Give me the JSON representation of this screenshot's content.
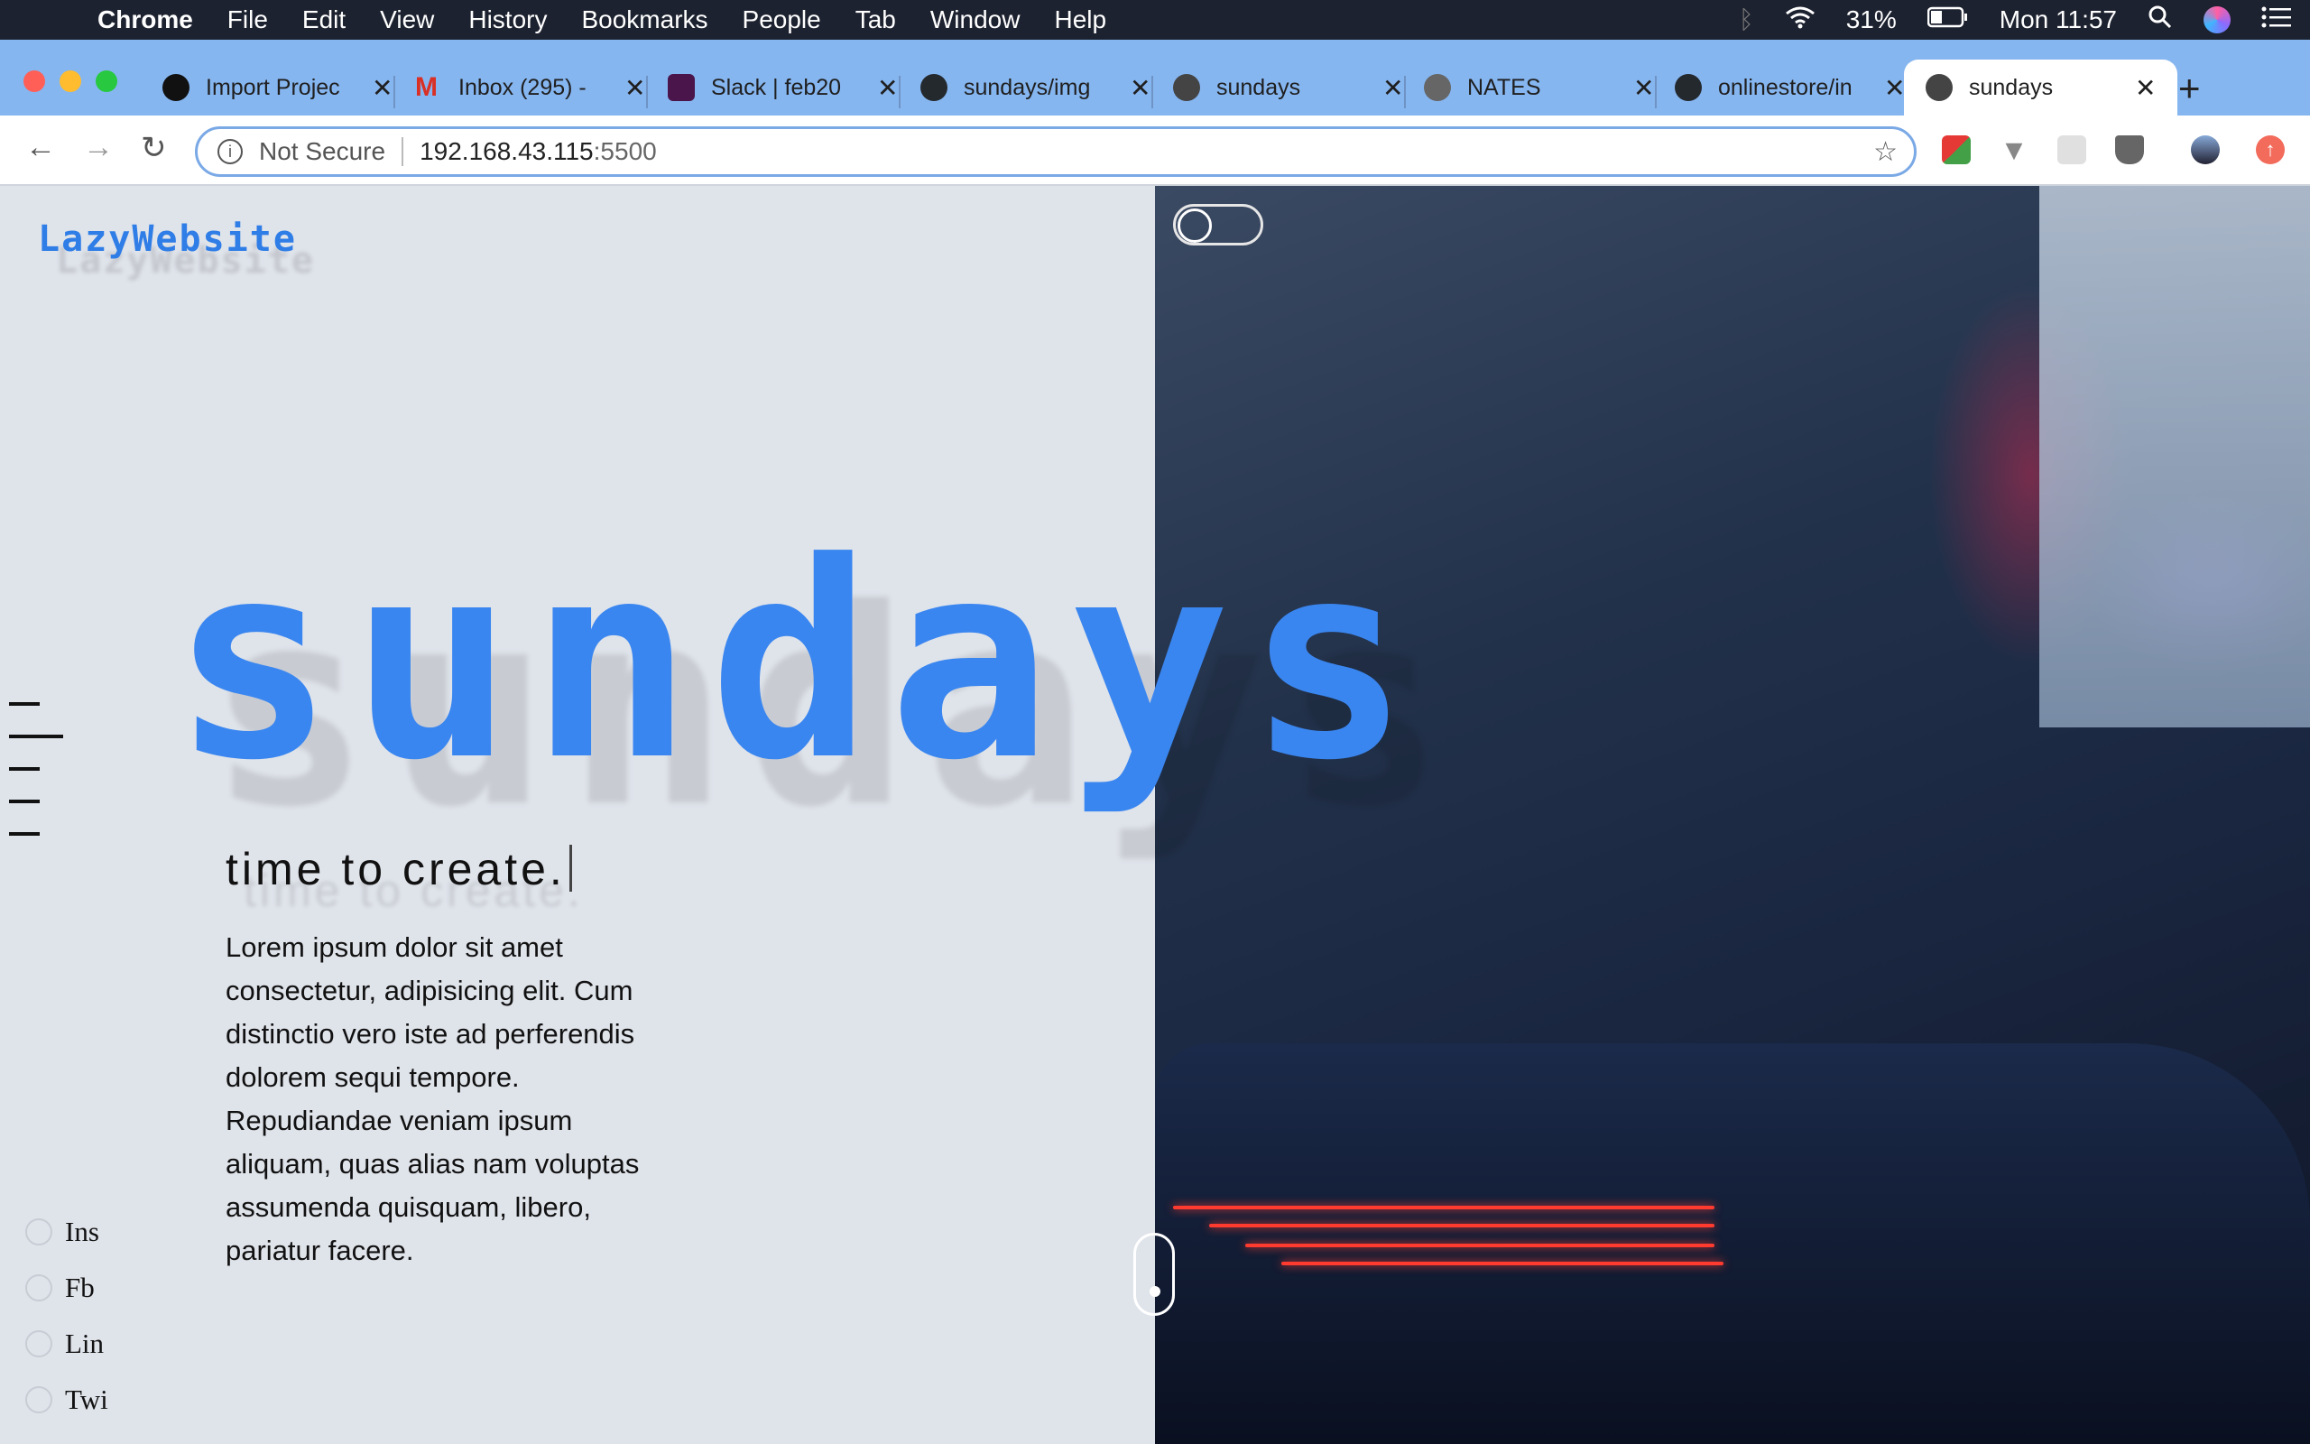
{
  "menubar": {
    "app": "Chrome",
    "items": [
      "File",
      "Edit",
      "View",
      "History",
      "Bookmarks",
      "People",
      "Tab",
      "Window",
      "Help"
    ],
    "battery": "31%",
    "clock": "Mon 11:57"
  },
  "tabs": [
    {
      "title": "Import Projec",
      "icon_color": "#111111",
      "icon": "vercel-icon"
    },
    {
      "title": "Inbox (295) -",
      "icon_color": "#d93025",
      "icon": "gmail-icon"
    },
    {
      "title": "Slack | feb20",
      "icon_color": "#4a154b",
      "icon": "slack-icon"
    },
    {
      "title": "sundays/img",
      "icon_color": "#24292e",
      "icon": "github-icon"
    },
    {
      "title": "sundays",
      "icon_color": "#444444",
      "icon": "globe-icon"
    },
    {
      "title": "NATES",
      "icon_color": "#555555",
      "icon": "page-icon"
    },
    {
      "title": "onlinestore/in",
      "icon_color": "#24292e",
      "icon": "github-icon"
    },
    {
      "title": "sundays",
      "icon_color": "#444444",
      "icon": "globe-icon",
      "active": true
    }
  ],
  "toolbar": {
    "security": "Not Secure",
    "url_host": "192.168.43.115",
    "url_port": ":5500"
  },
  "page": {
    "logo": "LazyWebsite",
    "title": "sundays",
    "tagline": "time to create.",
    "body": "Lorem ipsum dolor sit amet consectetur, adipisicing elit. Cum distinctio vero iste ad perferendis dolorem sequi tempore. Repudiandae veniam ipsum aliquam, quas alias nam voluptas assumenda quisquam, libero, pariatur facere.",
    "socials": [
      "Ins",
      "Fb",
      "Lin",
      "Twi"
    ]
  },
  "colors": {
    "accent": "#3a86f0",
    "page_bg": "#dfe3ea",
    "tabstrip": "#86b6f0"
  }
}
